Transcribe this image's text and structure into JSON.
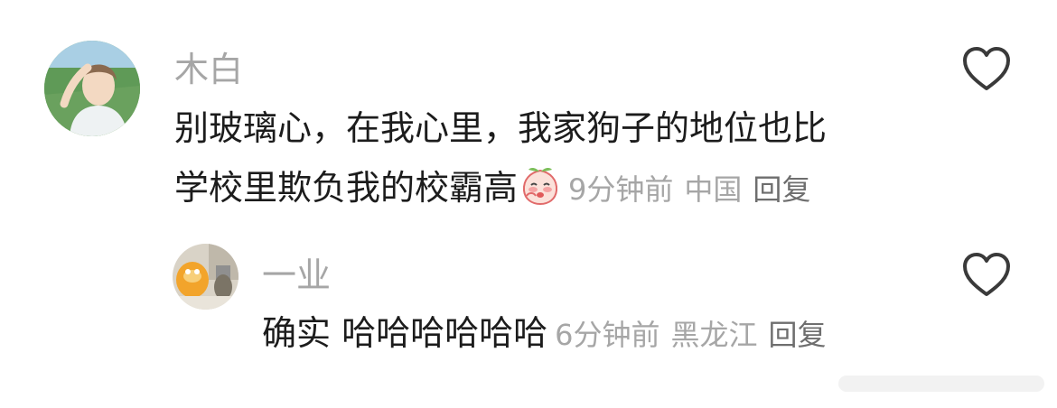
{
  "comments": [
    {
      "username": "木白",
      "text_line1": "别玻璃心，在我心里，我家狗子的地位也比",
      "text_line2": "学校里欺负我的校霸高",
      "emoji_icon": "peach-blush-emoji",
      "time": "9分钟前",
      "location": "中国",
      "reply_label": "回复",
      "like_icon": "heart-outline-icon"
    },
    {
      "username": "一业",
      "text": "确实 哈哈哈哈哈哈",
      "time": "6分钟前",
      "location": "黑龙江",
      "reply_label": "回复",
      "like_icon": "heart-outline-icon"
    }
  ],
  "colors": {
    "username": "#a6a6a6",
    "text": "#1c1c1c",
    "meta": "#a6a6a6",
    "reply": "#6e6e6e"
  }
}
